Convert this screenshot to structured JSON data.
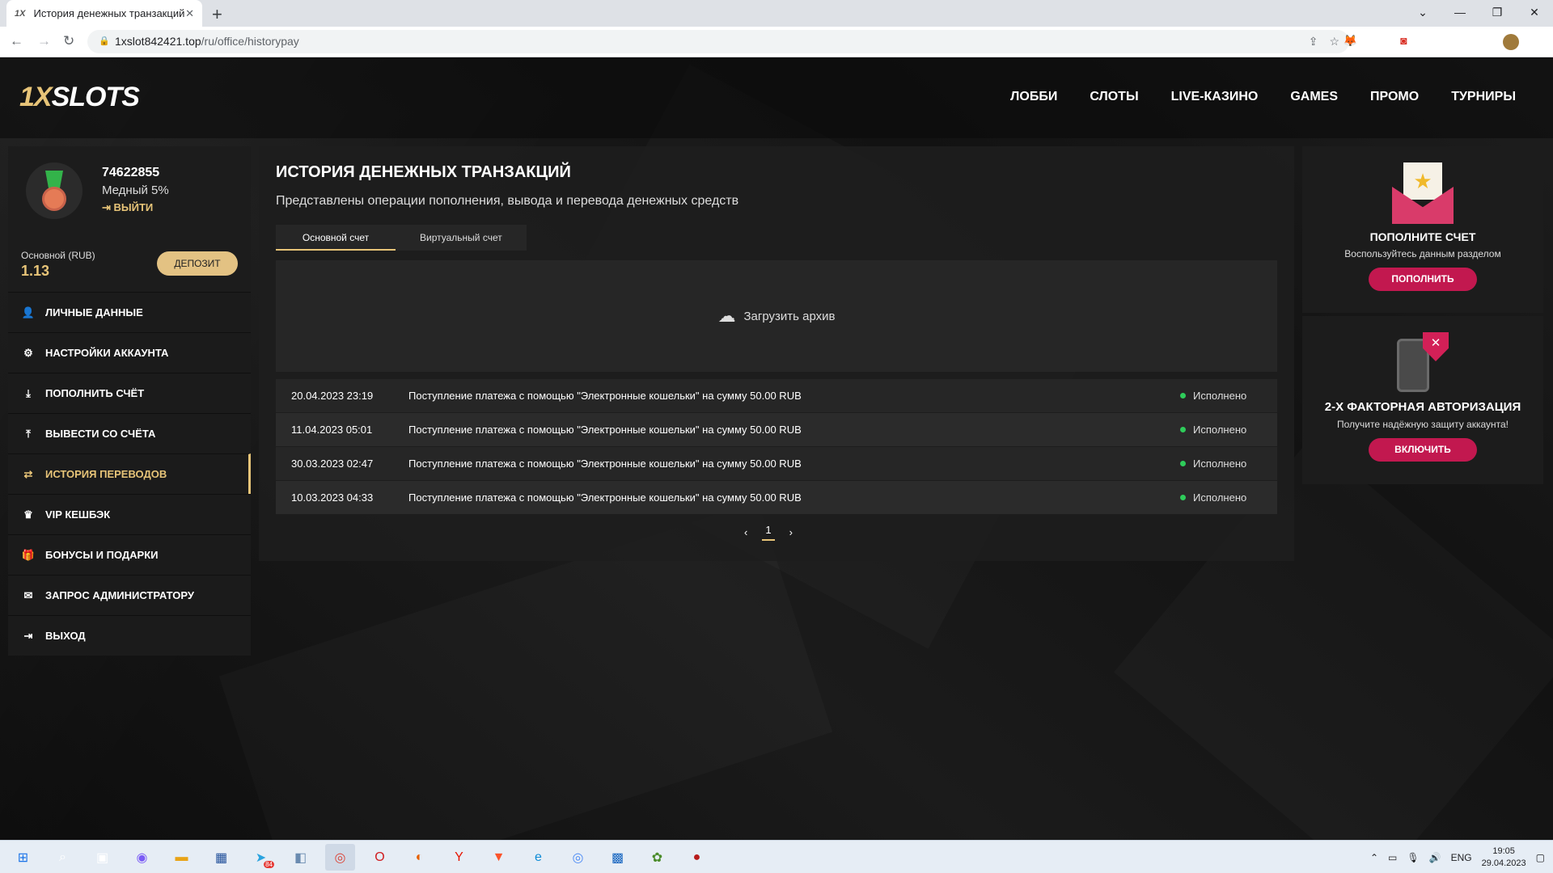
{
  "browser": {
    "tab_title": "История денежных транзакций",
    "tab_favicon": "1X",
    "url_domain": "1xslot842421.top",
    "url_path": "/ru/office/historypay"
  },
  "site": {
    "logo_part1": "1X",
    "logo_part2": "SLOTS",
    "nav": [
      "ЛОББИ",
      "СЛОТЫ",
      "LIVE-КАЗИНО",
      "GAMES",
      "ПРОМО",
      "ТУРНИРЫ"
    ]
  },
  "profile": {
    "user_id": "74622855",
    "level": "Медный 5%",
    "logout": "ВЫЙТИ",
    "balance_label": "Основной (RUB)",
    "balance_value": "1.13",
    "deposit_button": "ДЕПОЗИТ"
  },
  "menu": [
    {
      "label": "ЛИЧНЫЕ ДАННЫЕ",
      "icon": "user-icon"
    },
    {
      "label": "НАСТРОЙКИ АККАУНТА",
      "icon": "gear-icon"
    },
    {
      "label": "ПОПОЛНИТЬ СЧЁТ",
      "icon": "download-icon"
    },
    {
      "label": "ВЫВЕСТИ СО СЧЁТА",
      "icon": "upload-icon"
    },
    {
      "label": "ИСТОРИЯ ПЕРЕВОДОВ",
      "icon": "transfer-icon",
      "active": true
    },
    {
      "label": "VIP КЕШБЭК",
      "icon": "crown-icon"
    },
    {
      "label": "БОНУСЫ И ПОДАРКИ",
      "icon": "gift-icon"
    },
    {
      "label": "ЗАПРОС АДМИНИСТРАТОРУ",
      "icon": "mail-icon"
    },
    {
      "label": "ВЫХОД",
      "icon": "logout-icon"
    }
  ],
  "main": {
    "title": "ИСТОРИЯ ДЕНЕЖНЫХ ТРАНЗАКЦИЙ",
    "subtitle": "Представлены операции пополнения, вывода и перевода денежных средств",
    "tabs": [
      "Основной счет",
      "Виртуальный счет"
    ],
    "archive": "Загрузить архив",
    "transactions": [
      {
        "date": "20.04.2023 23:19",
        "desc": "Поступление платежа с помощью \"Электронные кошельки\" на сумму 50.00 RUB",
        "status": "Исполнено"
      },
      {
        "date": "11.04.2023 05:01",
        "desc": "Поступление платежа с помощью \"Электронные кошельки\" на сумму 50.00 RUB",
        "status": "Исполнено"
      },
      {
        "date": "30.03.2023 02:47",
        "desc": "Поступление платежа с помощью \"Электронные кошельки\" на сумму 50.00 RUB",
        "status": "Исполнено"
      },
      {
        "date": "10.03.2023 04:33",
        "desc": "Поступление платежа с помощью \"Электронные кошельки\" на сумму 50.00 RUB",
        "status": "Исполнено"
      }
    ],
    "page": "1"
  },
  "cards": {
    "deposit_title": "ПОПОЛНИТЕ СЧЕТ",
    "deposit_text": "Воспользуйтесь данным разделом",
    "deposit_button": "ПОПОЛНИТЬ",
    "twofa_title": "2-Х ФАКТОРНАЯ АВТОРИЗАЦИЯ",
    "twofa_text": "Получите надёжную защиту аккаунта!",
    "twofa_button": "ВКЛЮЧИТЬ"
  },
  "taskbar": {
    "language": "ENG",
    "time": "19:05",
    "date": "29.04.2023",
    "telegram_badge": "84"
  },
  "colors": {
    "accent_gold": "#e7c478",
    "card_button": "#c2184f",
    "status_ok": "#2ecc5a"
  }
}
